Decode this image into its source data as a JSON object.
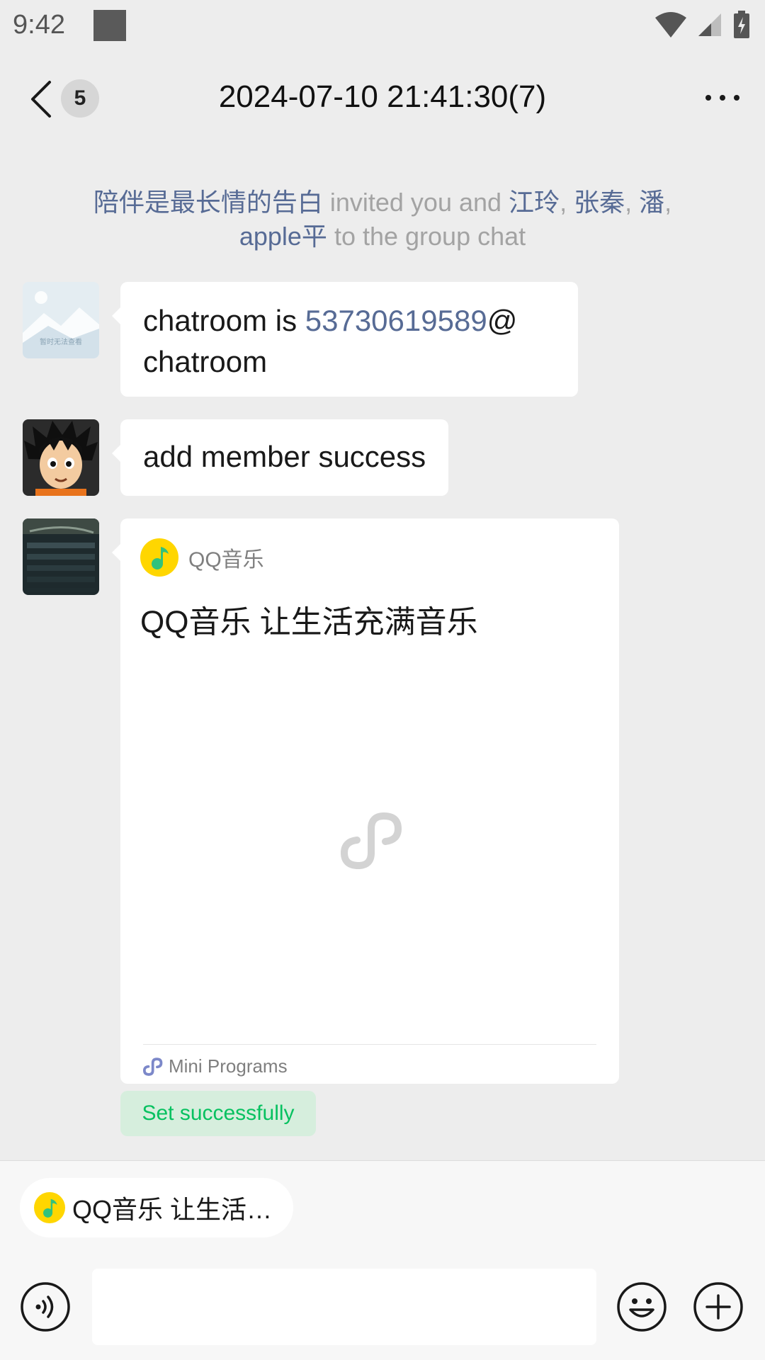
{
  "status_bar": {
    "time": "9:42"
  },
  "header": {
    "back_count": "5",
    "title": "2024-07-10 21:41:30(7)"
  },
  "system_message": {
    "inviter": "陪伴是最长情的告白",
    "invited_text_1": " invited you and ",
    "members": [
      "江玲",
      "张秦",
      "潘",
      "apple平"
    ],
    "separator": ", ",
    "tail_text": " to the group chat"
  },
  "messages": [
    {
      "avatar_caption": "暂时无法查看",
      "text_before": "chatroom is ",
      "link_number": "53730619589",
      "text_after": "@ chatroom"
    },
    {
      "text": "add member success"
    }
  ],
  "mini_program": {
    "app_name": "QQ音乐",
    "title": "QQ音乐 让生活充满音乐",
    "footer_label": "Mini Programs",
    "app_color": "#ffd600",
    "note_color": "#31c27c"
  },
  "status_tag": {
    "label": "Set successfully",
    "color": "#07c160"
  },
  "input_area": {
    "quote_text": "QQ音乐 让生活…",
    "input_value": ""
  },
  "colors": {
    "link": "#576b95",
    "background": "#ededed"
  }
}
